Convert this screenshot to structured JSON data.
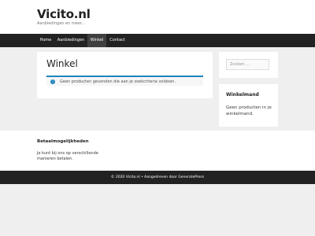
{
  "header": {
    "site_title": "Vicito.nl",
    "tagline": "Aanbiedingen en meer..."
  },
  "nav": {
    "items": [
      {
        "label": "Home",
        "active": false
      },
      {
        "label": "Aanbiedingen",
        "active": false
      },
      {
        "label": "Winkel",
        "active": true
      },
      {
        "label": "Contact",
        "active": false
      }
    ]
  },
  "main": {
    "page_title": "Winkel",
    "notice": "Geen producten gevonden die aan je zoekcriteria voldoen.",
    "notice_icon": "info-icon"
  },
  "sidebar": {
    "search_placeholder": "Zoeken …",
    "cart_title": "Winkelmand",
    "cart_empty": "Geen producten in je winkelmand."
  },
  "footer_widget": {
    "title": "Betaalmogelijkheden",
    "text": "Je kunt bij ons op verschillende manieren betalen."
  },
  "footer": {
    "copyright": "© 2020 Vicito.nl • Aangedreven door GeneratePress"
  },
  "colors": {
    "nav_bg": "#222222",
    "nav_active": "#3f3f3f",
    "notice_border": "#1e85be",
    "page_bg": "#efefef"
  }
}
